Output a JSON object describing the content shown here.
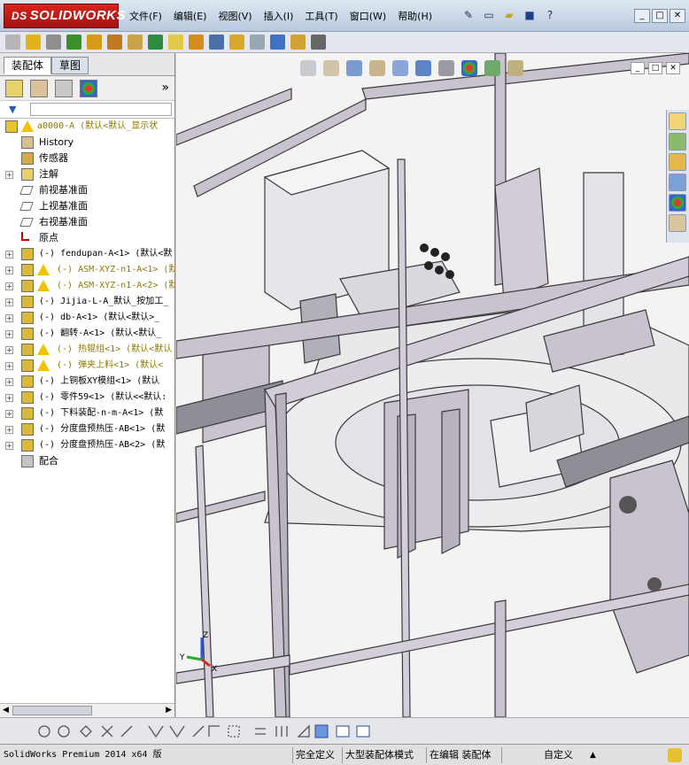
{
  "app": {
    "logo_prefix": "DS",
    "logo_text": "SOLIDWORKS"
  },
  "menu": [
    "文件(F)",
    "编辑(E)",
    "视图(V)",
    "插入(I)",
    "工具(T)",
    "窗口(W)",
    "帮助(H)"
  ],
  "window_controls": [
    "_",
    "□",
    "✕"
  ],
  "panel": {
    "tabs": {
      "assembly": "装配体",
      "sketch": "草图"
    },
    "expand_glyph": "»"
  },
  "tree": [
    {
      "label": "a0000-A  (默认<默认_显示状",
      "warn": true,
      "style": "olive",
      "indent": 0,
      "icon": "assembly-root-icon"
    },
    {
      "label": "History",
      "indent": 1,
      "icon": "history-icon"
    },
    {
      "label": "传感器",
      "indent": 1,
      "icon": "sensor-icon"
    },
    {
      "label": "注解",
      "indent": 1,
      "icon": "annotation-icon",
      "expand": true
    },
    {
      "label": "前视基准面",
      "indent": 1,
      "icon": "plane-icon"
    },
    {
      "label": "上视基准面",
      "indent": 1,
      "icon": "plane-icon"
    },
    {
      "label": "右视基准面",
      "indent": 1,
      "icon": "plane-icon"
    },
    {
      "label": "原点",
      "indent": 1,
      "icon": "origin-icon"
    },
    {
      "label": "(-) fendupan-A<1> (默认<默",
      "indent": 1,
      "icon": "component-icon",
      "expand": true
    },
    {
      "label": "(-) ASM-XYZ-n1-A<1> (默",
      "warn": true,
      "style": "olive",
      "indent": 1,
      "icon": "component-icon",
      "expand": true
    },
    {
      "label": "(-) ASM-XYZ-n1-A<2> (默",
      "warn": true,
      "style": "olive",
      "indent": 1,
      "icon": "component-icon",
      "expand": true
    },
    {
      "label": "(-) Jijia-L-A_默认_按加工_",
      "indent": 1,
      "icon": "component-icon",
      "expand": true
    },
    {
      "label": "(-) db-A<1> (默认<默认>_",
      "indent": 1,
      "icon": "component-icon",
      "expand": true
    },
    {
      "label": "(-) 翻转-A<1> (默认<默认_",
      "indent": 1,
      "icon": "component-icon",
      "expand": true
    },
    {
      "label": "(-) 热辊组<1> (默认<默认",
      "warn": true,
      "style": "olive",
      "indent": 1,
      "icon": "component-icon",
      "expand": true
    },
    {
      "label": "(-) 弹夹上料<1> (默认<",
      "warn": true,
      "style": "olive",
      "indent": 1,
      "icon": "component-icon",
      "expand": true
    },
    {
      "label": "(-) 上铜板XY模组<1> (默认",
      "indent": 1,
      "icon": "component-icon",
      "expand": true
    },
    {
      "label": "(-) 零件59<1> (默认<<默认:",
      "indent": 1,
      "icon": "component-icon",
      "expand": true
    },
    {
      "label": "(-) 下料装配-n-m-A<1> (默",
      "indent": 1,
      "icon": "component-icon",
      "expand": true
    },
    {
      "label": "(-) 分度盘预热压-AB<1> (默",
      "indent": 1,
      "icon": "component-icon",
      "expand": true
    },
    {
      "label": "(-) 分度盘预热压-AB<2> (默",
      "indent": 1,
      "icon": "component-icon",
      "expand": true
    },
    {
      "label": "配合",
      "indent": 1,
      "icon": "mates-icon"
    }
  ],
  "triad": {
    "x": "X",
    "y": "Y",
    "z": "Z"
  },
  "status": {
    "product": "SolidWorks Premium 2014 x64 版",
    "definition": "完全定义",
    "mode": "大型装配体模式",
    "editing": "在编辑 装配体",
    "custom": "自定义",
    "caret": "▲"
  },
  "colors": {
    "frame": "#c9c3cf",
    "frame_edge": "#3a3a3a",
    "background": "#f3f3f4",
    "logo_red": "#c41d17",
    "warning": "#f2c200",
    "olive_text": "#8c7a00"
  }
}
